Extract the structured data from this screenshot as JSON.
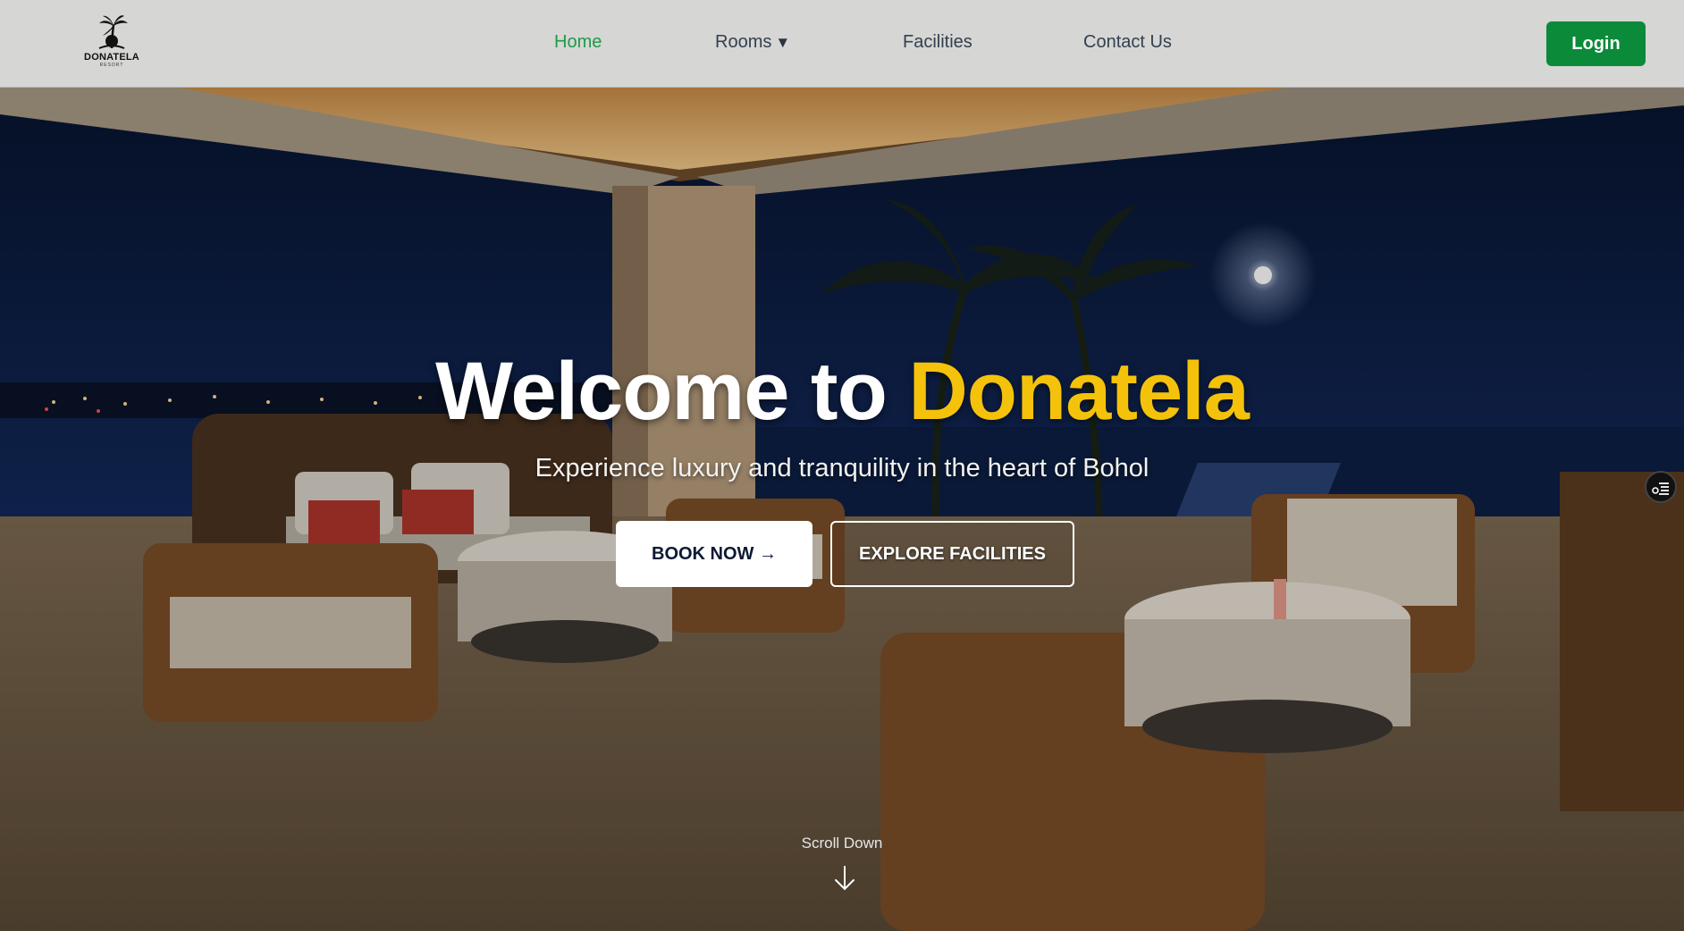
{
  "brand": {
    "name": "DONATELA",
    "sub": "RESORT"
  },
  "nav": {
    "items": [
      {
        "label": "Home",
        "active": true
      },
      {
        "label": "Rooms",
        "caret": "▼"
      },
      {
        "label": "Facilities"
      },
      {
        "label": "Contact Us"
      }
    ],
    "login_label": "Login"
  },
  "hero": {
    "title_prefix": "Welcome to ",
    "title_accent": "Donatela",
    "subtitle": "Experience luxury and tranquility in the heart of Bohol",
    "book_label": "BOOK NOW →",
    "explore_label": "EXPLORE FACILITIES",
    "scroll_label": "Scroll Down"
  },
  "colors": {
    "accent_green": "#0b8a3a",
    "active_link": "#1f9a4a",
    "title_accent": "#f5c20b",
    "nav_bg": "#d6d6d4"
  },
  "icons": {
    "logo": "palm-tree-icon",
    "scroll": "arrow-down-icon",
    "widget": "settings-list-icon"
  }
}
